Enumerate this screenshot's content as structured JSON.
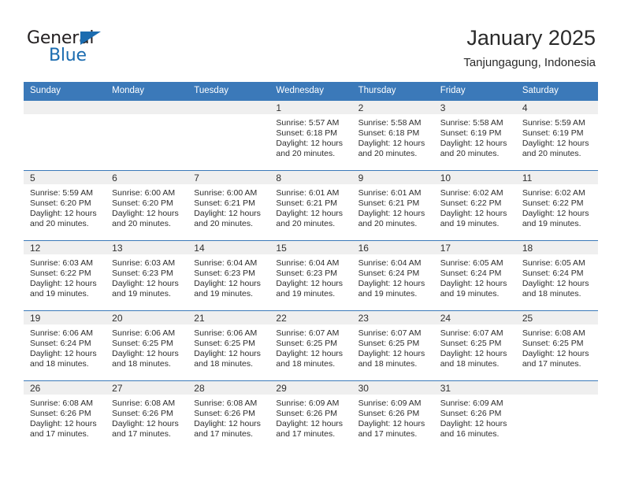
{
  "brand": {
    "name_part1": "General",
    "name_part2": "Blue",
    "accent_color": "#1b6cb0"
  },
  "header": {
    "title": "January 2025",
    "subtitle": "Tanjungagung, Indonesia"
  },
  "theme": {
    "header_blue": "#3b79b9",
    "daynum_gray": "#efefef",
    "text": "#2d2d2d"
  },
  "weekday_headers": [
    "Sunday",
    "Monday",
    "Tuesday",
    "Wednesday",
    "Thursday",
    "Friday",
    "Saturday"
  ],
  "weeks": [
    [
      {
        "day": "",
        "sunrise": "",
        "sunset": "",
        "daylight": "",
        "daylight2": ""
      },
      {
        "day": "",
        "sunrise": "",
        "sunset": "",
        "daylight": "",
        "daylight2": ""
      },
      {
        "day": "",
        "sunrise": "",
        "sunset": "",
        "daylight": "",
        "daylight2": ""
      },
      {
        "day": "1",
        "sunrise": "Sunrise: 5:57 AM",
        "sunset": "Sunset: 6:18 PM",
        "daylight": "Daylight: 12 hours",
        "daylight2": "and 20 minutes."
      },
      {
        "day": "2",
        "sunrise": "Sunrise: 5:58 AM",
        "sunset": "Sunset: 6:18 PM",
        "daylight": "Daylight: 12 hours",
        "daylight2": "and 20 minutes."
      },
      {
        "day": "3",
        "sunrise": "Sunrise: 5:58 AM",
        "sunset": "Sunset: 6:19 PM",
        "daylight": "Daylight: 12 hours",
        "daylight2": "and 20 minutes."
      },
      {
        "day": "4",
        "sunrise": "Sunrise: 5:59 AM",
        "sunset": "Sunset: 6:19 PM",
        "daylight": "Daylight: 12 hours",
        "daylight2": "and 20 minutes."
      }
    ],
    [
      {
        "day": "5",
        "sunrise": "Sunrise: 5:59 AM",
        "sunset": "Sunset: 6:20 PM",
        "daylight": "Daylight: 12 hours",
        "daylight2": "and 20 minutes."
      },
      {
        "day": "6",
        "sunrise": "Sunrise: 6:00 AM",
        "sunset": "Sunset: 6:20 PM",
        "daylight": "Daylight: 12 hours",
        "daylight2": "and 20 minutes."
      },
      {
        "day": "7",
        "sunrise": "Sunrise: 6:00 AM",
        "sunset": "Sunset: 6:21 PM",
        "daylight": "Daylight: 12 hours",
        "daylight2": "and 20 minutes."
      },
      {
        "day": "8",
        "sunrise": "Sunrise: 6:01 AM",
        "sunset": "Sunset: 6:21 PM",
        "daylight": "Daylight: 12 hours",
        "daylight2": "and 20 minutes."
      },
      {
        "day": "9",
        "sunrise": "Sunrise: 6:01 AM",
        "sunset": "Sunset: 6:21 PM",
        "daylight": "Daylight: 12 hours",
        "daylight2": "and 20 minutes."
      },
      {
        "day": "10",
        "sunrise": "Sunrise: 6:02 AM",
        "sunset": "Sunset: 6:22 PM",
        "daylight": "Daylight: 12 hours",
        "daylight2": "and 19 minutes."
      },
      {
        "day": "11",
        "sunrise": "Sunrise: 6:02 AM",
        "sunset": "Sunset: 6:22 PM",
        "daylight": "Daylight: 12 hours",
        "daylight2": "and 19 minutes."
      }
    ],
    [
      {
        "day": "12",
        "sunrise": "Sunrise: 6:03 AM",
        "sunset": "Sunset: 6:22 PM",
        "daylight": "Daylight: 12 hours",
        "daylight2": "and 19 minutes."
      },
      {
        "day": "13",
        "sunrise": "Sunrise: 6:03 AM",
        "sunset": "Sunset: 6:23 PM",
        "daylight": "Daylight: 12 hours",
        "daylight2": "and 19 minutes."
      },
      {
        "day": "14",
        "sunrise": "Sunrise: 6:04 AM",
        "sunset": "Sunset: 6:23 PM",
        "daylight": "Daylight: 12 hours",
        "daylight2": "and 19 minutes."
      },
      {
        "day": "15",
        "sunrise": "Sunrise: 6:04 AM",
        "sunset": "Sunset: 6:23 PM",
        "daylight": "Daylight: 12 hours",
        "daylight2": "and 19 minutes."
      },
      {
        "day": "16",
        "sunrise": "Sunrise: 6:04 AM",
        "sunset": "Sunset: 6:24 PM",
        "daylight": "Daylight: 12 hours",
        "daylight2": "and 19 minutes."
      },
      {
        "day": "17",
        "sunrise": "Sunrise: 6:05 AM",
        "sunset": "Sunset: 6:24 PM",
        "daylight": "Daylight: 12 hours",
        "daylight2": "and 19 minutes."
      },
      {
        "day": "18",
        "sunrise": "Sunrise: 6:05 AM",
        "sunset": "Sunset: 6:24 PM",
        "daylight": "Daylight: 12 hours",
        "daylight2": "and 18 minutes."
      }
    ],
    [
      {
        "day": "19",
        "sunrise": "Sunrise: 6:06 AM",
        "sunset": "Sunset: 6:24 PM",
        "daylight": "Daylight: 12 hours",
        "daylight2": "and 18 minutes."
      },
      {
        "day": "20",
        "sunrise": "Sunrise: 6:06 AM",
        "sunset": "Sunset: 6:25 PM",
        "daylight": "Daylight: 12 hours",
        "daylight2": "and 18 minutes."
      },
      {
        "day": "21",
        "sunrise": "Sunrise: 6:06 AM",
        "sunset": "Sunset: 6:25 PM",
        "daylight": "Daylight: 12 hours",
        "daylight2": "and 18 minutes."
      },
      {
        "day": "22",
        "sunrise": "Sunrise: 6:07 AM",
        "sunset": "Sunset: 6:25 PM",
        "daylight": "Daylight: 12 hours",
        "daylight2": "and 18 minutes."
      },
      {
        "day": "23",
        "sunrise": "Sunrise: 6:07 AM",
        "sunset": "Sunset: 6:25 PM",
        "daylight": "Daylight: 12 hours",
        "daylight2": "and 18 minutes."
      },
      {
        "day": "24",
        "sunrise": "Sunrise: 6:07 AM",
        "sunset": "Sunset: 6:25 PM",
        "daylight": "Daylight: 12 hours",
        "daylight2": "and 18 minutes."
      },
      {
        "day": "25",
        "sunrise": "Sunrise: 6:08 AM",
        "sunset": "Sunset: 6:25 PM",
        "daylight": "Daylight: 12 hours",
        "daylight2": "and 17 minutes."
      }
    ],
    [
      {
        "day": "26",
        "sunrise": "Sunrise: 6:08 AM",
        "sunset": "Sunset: 6:26 PM",
        "daylight": "Daylight: 12 hours",
        "daylight2": "and 17 minutes."
      },
      {
        "day": "27",
        "sunrise": "Sunrise: 6:08 AM",
        "sunset": "Sunset: 6:26 PM",
        "daylight": "Daylight: 12 hours",
        "daylight2": "and 17 minutes."
      },
      {
        "day": "28",
        "sunrise": "Sunrise: 6:08 AM",
        "sunset": "Sunset: 6:26 PM",
        "daylight": "Daylight: 12 hours",
        "daylight2": "and 17 minutes."
      },
      {
        "day": "29",
        "sunrise": "Sunrise: 6:09 AM",
        "sunset": "Sunset: 6:26 PM",
        "daylight": "Daylight: 12 hours",
        "daylight2": "and 17 minutes."
      },
      {
        "day": "30",
        "sunrise": "Sunrise: 6:09 AM",
        "sunset": "Sunset: 6:26 PM",
        "daylight": "Daylight: 12 hours",
        "daylight2": "and 17 minutes."
      },
      {
        "day": "31",
        "sunrise": "Sunrise: 6:09 AM",
        "sunset": "Sunset: 6:26 PM",
        "daylight": "Daylight: 12 hours",
        "daylight2": "and 16 minutes."
      },
      {
        "day": "",
        "sunrise": "",
        "sunset": "",
        "daylight": "",
        "daylight2": ""
      }
    ]
  ]
}
